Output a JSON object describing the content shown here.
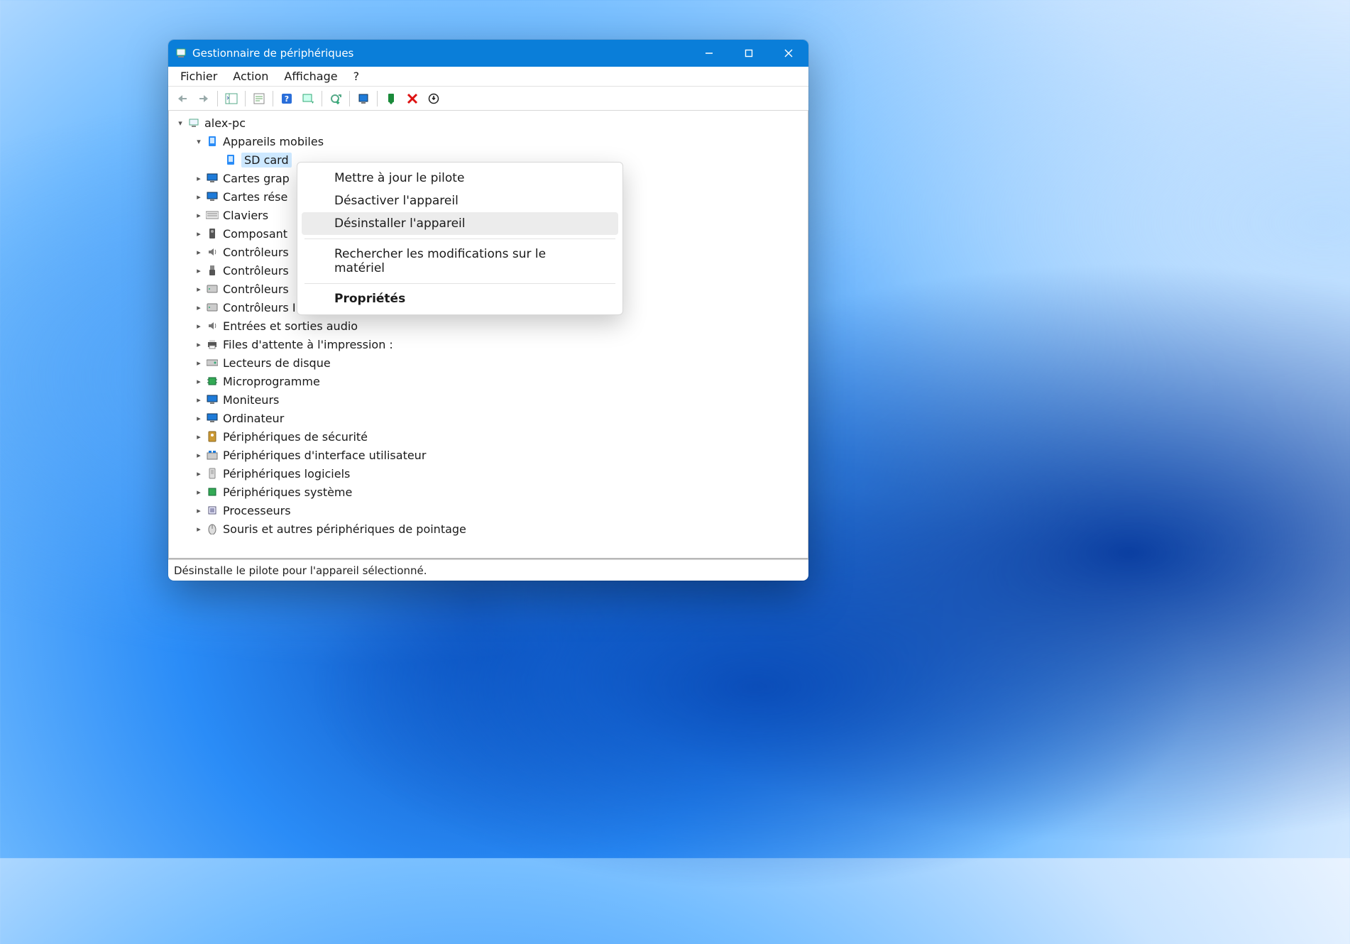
{
  "window": {
    "title": "Gestionnaire de périphériques"
  },
  "menubar": {
    "file": "Fichier",
    "action": "Action",
    "view": "Affichage",
    "help": "?"
  },
  "tree": {
    "root": "alex-pc",
    "cat_mobile": "Appareils mobiles",
    "item_sdcard": "SD card",
    "cat_gpu": "Cartes grap",
    "cat_net": "Cartes rése",
    "cat_keyb": "Claviers",
    "cat_composant": "Composant",
    "cat_ctrl1": "Contrôleurs",
    "cat_ctrl2": "Contrôleurs",
    "cat_ctrl3": "Contrôleurs",
    "cat_ide": "Contrôleurs IDE ATA/ATAPI",
    "cat_audio": "Entrées et sorties audio",
    "cat_print": "Files d'attente à l'impression :",
    "cat_disk": "Lecteurs de disque",
    "cat_fw": "Microprogramme",
    "cat_mon": "Moniteurs",
    "cat_pc": "Ordinateur",
    "cat_sec": "Périphériques de sécurité",
    "cat_hid": "Périphériques d'interface utilisateur",
    "cat_soft": "Périphériques logiciels",
    "cat_sys": "Périphériques système",
    "cat_cpu": "Processeurs",
    "cat_mouse": "Souris et autres périphériques de pointage"
  },
  "context": {
    "update": "Mettre à jour le pilote",
    "disable": "Désactiver l'appareil",
    "uninstall": "Désinstaller l'appareil",
    "scan": "Rechercher les modifications sur le matériel",
    "properties": "Propriétés"
  },
  "status": "Désinstalle le pilote pour l'appareil sélectionné."
}
